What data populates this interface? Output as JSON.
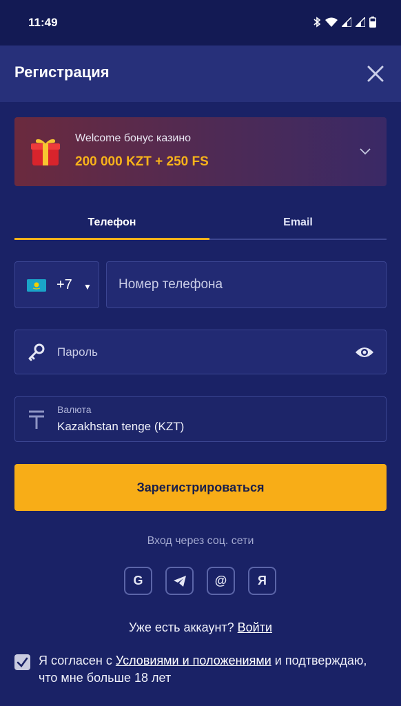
{
  "status_bar": {
    "time": "11:49"
  },
  "header": {
    "title": "Регистрация"
  },
  "bonus": {
    "label": "Welcome бонус казино",
    "amount": "200 000 KZT + 250 FS"
  },
  "tabs": [
    {
      "label": "Телефон",
      "active": true
    },
    {
      "label": "Email",
      "active": false
    }
  ],
  "phone": {
    "country_code": "+7",
    "placeholder": "Номер телефона"
  },
  "password": {
    "placeholder": "Пароль"
  },
  "currency": {
    "label": "Валюта",
    "value": "Kazakhstan tenge (KZT)"
  },
  "submit_label": "Зарегистрироваться",
  "social": {
    "label": "Вход через соц. сети",
    "buttons": [
      {
        "icon": "google-icon",
        "glyph": "G"
      },
      {
        "icon": "telegram-icon",
        "glyph": ""
      },
      {
        "icon": "mail-ru-icon",
        "glyph": "@"
      },
      {
        "icon": "yandex-icon",
        "glyph": "Я"
      }
    ]
  },
  "login": {
    "prompt": "Уже есть аккаунт?",
    "link": "Войти"
  },
  "agreement": {
    "checked": true,
    "prefix": "Я согласен с",
    "link": "Условиями и положениями",
    "suffix": "и подтверждаю, что мне больше 18 лет"
  },
  "colors": {
    "background": "#1a2266",
    "accent": "#f8ad17",
    "header": "#27307a"
  }
}
